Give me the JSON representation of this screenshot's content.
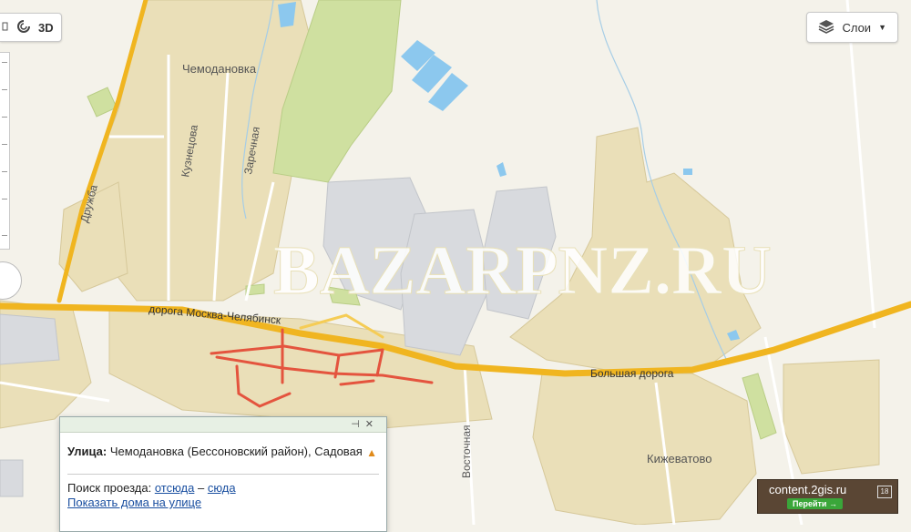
{
  "toolbar": {
    "back_icon": "back-icon",
    "rotate_icon": "rotate-icon",
    "mode_3d_label": "3D"
  },
  "layers_button": {
    "label": "Слои",
    "icon": "layers-icon"
  },
  "map_labels": {
    "village_chemodanovka": "Чемодановка",
    "village_kizhevatovo": "Кижеватово",
    "street_kuznetsova": "Кузнецова",
    "street_zarechnaya": "Заречная",
    "street_druzhba": "Дружба",
    "street_vostochnaya": "Восточная",
    "road_moscow_chelyabinsk": "дорога Москва-Челябинск",
    "road_bolshaya": "Большая дорога"
  },
  "watermark": "BAZARPNZ.RU",
  "popup": {
    "street_label": "Улица:",
    "street_value": "Чемодановка (Бессоновский район), Садовая",
    "route_label": "Поиск проезда:",
    "route_from": "отсюда",
    "route_dash": "–",
    "route_to": "сюда",
    "show_houses": "Показать дома на улице"
  },
  "ad": {
    "site": "content.2gis.ru",
    "cta": "Перейти →",
    "badge": "18"
  },
  "colors": {
    "background": "#f4f2ea",
    "settlement": "#eadfb8",
    "field_green": "#cfe0a0",
    "road_major": "#f0b520",
    "road_minor": "#ffffff",
    "water": "#8cc8ee",
    "highlight_route": "#e4543e",
    "industrial": "#d8dade"
  }
}
